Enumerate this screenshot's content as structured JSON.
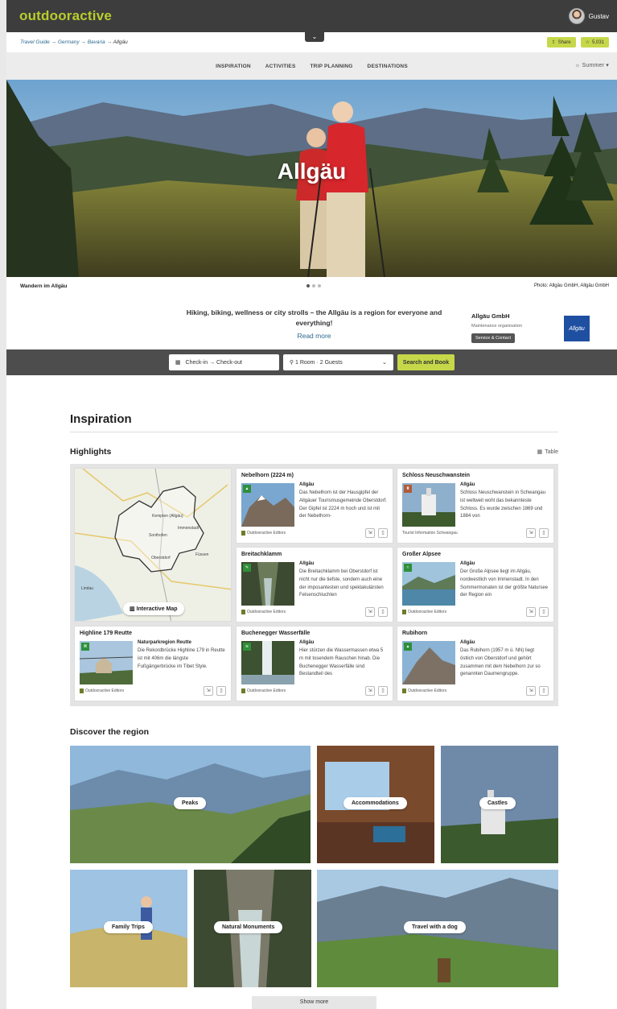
{
  "app": {
    "logo": "outdooractive",
    "user": "Gustav"
  },
  "breadcrumb": {
    "items": [
      "Travel Guide",
      "Germany",
      "Bavaria"
    ],
    "sep": " → ",
    "current": "Allgäu"
  },
  "actions": {
    "share": "Share",
    "rating": "5,031"
  },
  "nav": {
    "items": [
      "INSPIRATION",
      "ACTIVITIES",
      "TRIP PLANNING",
      "DESTINATIONS"
    ],
    "season": "Summer"
  },
  "hero": {
    "title": "Allgäu",
    "caption": "Wandern im Allgäu",
    "credit": "Photo: Allgäu GmbH, Allgäu GmbH"
  },
  "intro": {
    "text": "Hiking, biking, wellness or city strolls – the Allgäu is a region for everyone and everything!",
    "readmore": "Read more"
  },
  "org": {
    "name": "Allgäu GmbH",
    "role": "Maintenance organisation",
    "button": "Service & Contact",
    "logo": "Allgäu"
  },
  "booking": {
    "dates": "Check-in → Check-out",
    "guests": "1 Room · 2 Guests",
    "search": "Search and Book"
  },
  "inspiration": {
    "title": "Inspiration"
  },
  "highlights": {
    "title": "Highlights",
    "table_label": "Table",
    "map_button": "Interactive Map",
    "map_labels": [
      "Oberstdorf",
      "Immenstadt",
      "Sonthofen",
      "Kempten (Allgäu)",
      "Füssen",
      "Lindau"
    ],
    "cards": [
      {
        "title": "Nebelhorn (2224 m)",
        "region": "Allgäu",
        "desc": "Das Nebelhorn ist der Hausgipfel der Allgäuer Tourismusgemeinde Oberstdorf. Der Gipfel ist 2224 m hoch und ist mit der Nebelhorn-",
        "source": "Outdooractive Editors"
      },
      {
        "title": "Schloss Neuschwanstein",
        "region": "Allgäu",
        "desc": "Schloss Neuschwanstein in Schwangau ist weltweit wohl das bekannteste Schloss. Es wurde zwischen 1869 und 1884 von",
        "source": "Tourist Information Schwangau"
      },
      {
        "title": "Breitachklamm",
        "region": "Allgäu",
        "desc": "Die Breitachklamm bei Oberstdorf ist nicht nur die tiefste, sondern auch eine der imposantesten und spektakulärsten Felsenschluchten",
        "source": "Outdooractive Editors"
      },
      {
        "title": "Großer Alpsee",
        "region": "Allgäu",
        "desc": "Der Große Alpsee liegt im Allgäu, nordwestlich von Immenstadt. In den Sommermonaten ist der größte Natursee der Region ein",
        "source": "Outdooractive Editors"
      },
      {
        "title": "Highline 179 Reutte",
        "region": "Naturparkregion Reutte",
        "desc": "Die Rekordbrücke Highline 179 in Reutte ist mit 406m die längste Fußgängerbrücke im Tibet Style.",
        "source": "Outdooractive Editors"
      },
      {
        "title": "Buchenegger Wasserfälle",
        "region": "Allgäu",
        "desc": "Hier stürzen die Wassermassen etwa 5 m mit tosendem Rauschen hinab. Die Buchenegger Wasserfälle sind Bestandteil des",
        "source": "Outdooractive Editors"
      },
      {
        "title": "Rubihorn",
        "region": "Allgäu",
        "desc": "Das Rubihorn (1957 m ü. NN) liegt östlich von Oberstdorf und gehört zusammen mit dem Nebelhorn zur so genannten Daumengruppe.",
        "source": "Outdooractive Editors"
      }
    ]
  },
  "discover": {
    "title": "Discover the region",
    "tiles": [
      "Peaks",
      "Accommodations",
      "Castles",
      "Family Trips",
      "Natural Monuments",
      "Travel with a dog"
    ],
    "show_more": "Show more"
  },
  "colors": {
    "accent": "#c6d84a",
    "logo": "#b7cd2d",
    "dark": "#3d3d3d",
    "link": "#2b6a8f"
  }
}
